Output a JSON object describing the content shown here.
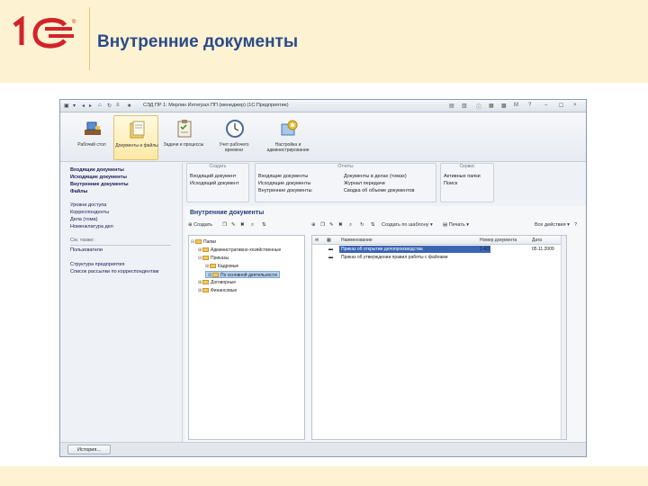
{
  "slide": {
    "title": "Внутренние документы"
  },
  "window": {
    "title": "СЭД ПР 1: Мерлин Интеграл ПП (менеджер) (1С:Предприятие)",
    "controls": [
      "i",
      "?",
      "☐",
      "×"
    ]
  },
  "sections": [
    {
      "label": "Рабочий стол",
      "icon": "desktop-icon"
    },
    {
      "label": "Документы и файлы",
      "icon": "documents-folder-icon"
    },
    {
      "label": "Задачи и процессы",
      "icon": "tasks-clipboard-icon"
    },
    {
      "label": "Учет рабочего времени",
      "icon": "clock-icon"
    },
    {
      "label": "Настройка и администрирование",
      "icon": "settings-icon"
    }
  ],
  "leftnav": {
    "group1": [
      "Входящие документы",
      "Исходящие документы",
      "Внутренние документы",
      "Файлы"
    ],
    "group2": [
      "Уровни доступа",
      "Корреспонденты",
      "Дела (тома)",
      "Номенклатура дел"
    ],
    "group3": [
      "См. также:",
      "Пользователи",
      "Структура предприятия",
      "Список рассылки по корреспондентам"
    ]
  },
  "command_groups": [
    {
      "title": "Создать",
      "items": [
        "Входящий документ",
        "Исходящий документ"
      ]
    },
    {
      "title": "Отчеты",
      "items": [
        "Входящие документы",
        "Исходящие документы",
        "Внутренние документы"
      ]
    },
    {
      "title": "Отчеты2",
      "items": [
        "Документы в делах (томах)",
        "Журнал передачи",
        "Сводка об объеме документов"
      ]
    },
    {
      "title": "Сервис",
      "items": [
        "Активные папки",
        "Поиск"
      ]
    }
  ],
  "main": {
    "title": "Внутренние документы",
    "toolbar_create": "Создать",
    "toolbar_right_create": "Создать по шаблону",
    "toolbar_print": "Печать",
    "toolbar_more": "Все действия"
  },
  "tree": [
    "Папки",
    "Административно-хозяйственные",
    "Приказы",
    "Кадровые",
    "По основной деятельности",
    "Договорные",
    "Финансовые"
  ],
  "list": {
    "columns": [
      "Наименование",
      "Номер документа",
      "Дата"
    ],
    "rows": [
      {
        "name": "Приказ об открытии делопроизводства",
        "number": "1-КО",
        "date": "05.11.2009"
      },
      {
        "name": "Приказ об утверждении правил работы с файлами",
        "number": "",
        "date": ""
      }
    ]
  },
  "statusbar": {
    "history_label": "История..."
  }
}
